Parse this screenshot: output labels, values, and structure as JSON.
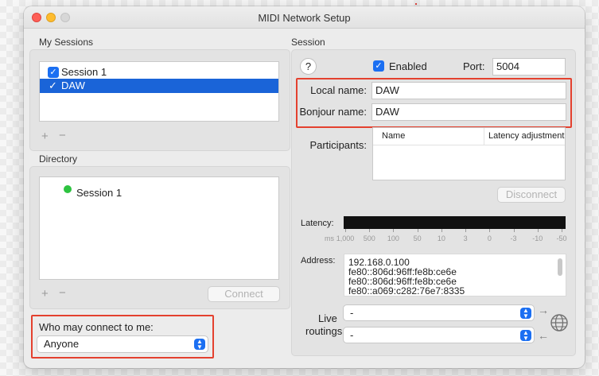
{
  "window": {
    "title": "MIDI Network Setup"
  },
  "my_sessions": {
    "label": "My Sessions",
    "items": [
      {
        "label": "Session 1",
        "checked": true,
        "selected": false
      },
      {
        "label": "DAW",
        "checked": true,
        "selected": true
      }
    ],
    "add": "+",
    "remove": "−"
  },
  "directory": {
    "label": "Directory",
    "items": [
      {
        "label": "Session 1",
        "status": "online"
      }
    ],
    "add": "+",
    "remove": "−",
    "connect_label": "Connect"
  },
  "who_may_connect": {
    "label": "Who may connect to me:",
    "value": "Anyone"
  },
  "session": {
    "label": "Session",
    "help": "?",
    "enabled_label": "Enabled",
    "enabled": true,
    "port_label": "Port:",
    "port_value": "5004",
    "local_name_label": "Local name:",
    "local_name_value": "DAW",
    "bonjour_name_label": "Bonjour name:",
    "bonjour_name_value": "DAW",
    "participants_label": "Participants:",
    "participants_columns": [
      "Name",
      "Latency adjustment"
    ],
    "disconnect_label": "Disconnect",
    "latency_label": "Latency:",
    "latency_unit": "ms",
    "latency_ticks": [
      "1,000",
      "500",
      "100",
      "50",
      "10",
      "3",
      "0",
      "-3",
      "-10",
      "-50"
    ],
    "address_label": "Address:",
    "addresses": [
      "192.168.0.100",
      "fe80::806d:96ff:fe8b:ce6e",
      "fe80::806d:96ff:fe8b:ce6e",
      "fe80::a069:c282:76e7:8335"
    ],
    "live_label": "Live",
    "routings_label": "routings",
    "routing_in": "-",
    "routing_out": "-"
  },
  "colors": {
    "accent": "#1b6ff2",
    "selection": "#1a64d8",
    "highlight_box": "#e4412f",
    "online": "#2dc340"
  }
}
